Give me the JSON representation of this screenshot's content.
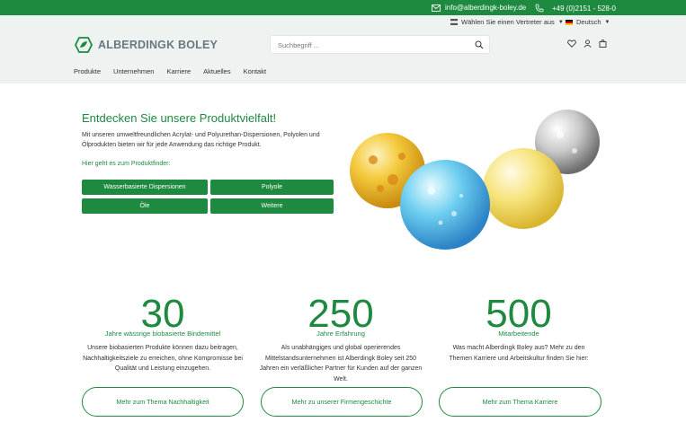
{
  "topbar": {
    "email": "info@alberdingk-boley.de",
    "phone": "+49 (0)2151 - 528-0"
  },
  "header": {
    "rep_select": "Wählen Sie einen Vertreter aus",
    "language": "Deutsch",
    "logo_text": "ALBERDINGK BOLEY",
    "search_placeholder": "Suchbegriff ..."
  },
  "nav": {
    "items": [
      "Produkte",
      "Unternehmen",
      "Karriere",
      "Aktuelles",
      "Kontakt"
    ]
  },
  "hero": {
    "title": "Entdecken Sie unsere Produktvielfalt!",
    "text": "Mit unseren umweltfreundlichen Acrylat- und Polyurethan-Dispersionen, Polyolen und Ölprodukten bieten wir für jede Anwendung das richtige Produkt.",
    "finder_link": "Hier geht es zum Produktfinder:",
    "buttons": [
      "Wasserbasierte Dispersionen",
      "Polyole",
      "Öle",
      "Weitere"
    ]
  },
  "stats": [
    {
      "number": "30",
      "label": "Jahre wässrige biobasierte Bindemittel",
      "text": "Unsere biobasierten Produkte können dazu beitragen, Nachhaltigkeitsziele zu erreichen, ohne Kompromisse bei Qualität und Leistung einzugehen.",
      "button": "Mehr zum Thema Nachhaltigkeit"
    },
    {
      "number": "250",
      "label": "Jahre Erfahrung",
      "text": "Als unabhängiges und global operierendes Mittelstandsunternehmen ist Alberdingk Boley seit 250 Jahren ein verläßlicher Partner für Kunden auf der ganzen Welt.",
      "button": "Mehr zu unserer Firmengeschichte"
    },
    {
      "number": "500",
      "label": "Mitarbeitende",
      "text": "Was macht Alberdingk Boley aus? Mehr zu den Themen Karriere und Arbeitskultur finden Sie hier:",
      "button": "Mehr zum Thema Karriere"
    }
  ],
  "colors": {
    "brand_green": "#1e8a3f",
    "header_bg": "#eef3f1"
  }
}
